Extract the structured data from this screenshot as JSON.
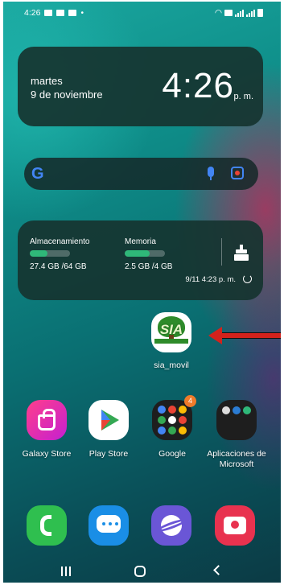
{
  "status_bar": {
    "time": "4:26",
    "left_icons": [
      "gmail-icon",
      "youtube-icon",
      "gmail-icon",
      "dot-icon"
    ],
    "right_icons": [
      "wifi-icon",
      "sim-icon",
      "signal-icon",
      "signal-icon",
      "battery-icon"
    ]
  },
  "clock_widget": {
    "day": "martes",
    "date": "9 de noviembre",
    "time": "4:26",
    "ampm": "p. m."
  },
  "search_bar": {
    "logo": "G",
    "icons": [
      "google-g-icon",
      "mic-icon",
      "lens-icon"
    ]
  },
  "device_care": {
    "storage_label": "Almacenamiento",
    "storage_value": "27.4 GB /64 GB",
    "storage_fraction": 0.43,
    "memory_label": "Memoria",
    "memory_value": "2.5 GB /4 GB",
    "memory_fraction": 0.62,
    "updated": "9/11 4:23 p. m.",
    "accent_color": "#2fb879"
  },
  "sia_app": {
    "label": "sia_movil",
    "icon_text": "SIA"
  },
  "apps": [
    {
      "label": "Galaxy Store"
    },
    {
      "label": "Play Store"
    },
    {
      "label": "Google",
      "badge": "4"
    },
    {
      "label": "Aplicaciones de Microsoft"
    }
  ],
  "dock": [
    "phone-icon",
    "messages-icon",
    "internet-icon",
    "camera-icon"
  ],
  "nav": [
    "recent-apps",
    "home",
    "back"
  ]
}
